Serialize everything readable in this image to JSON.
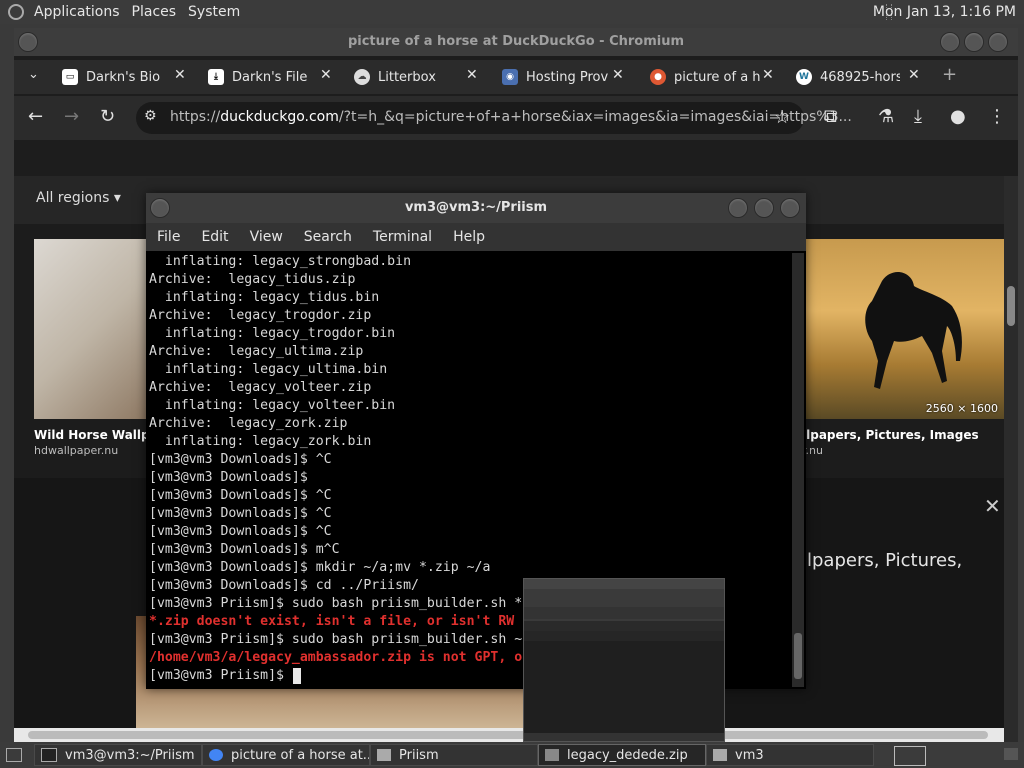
{
  "top_panel": {
    "menus": [
      "Applications",
      "Places",
      "System"
    ],
    "clock": "Mon Jan 13,  1:16 PM"
  },
  "chromium": {
    "title": "picture of a horse at DuckDuckGo - Chromium",
    "tabs": [
      {
        "label": "Darkn's Bio",
        "icon": "card-icon"
      },
      {
        "label": "Darkn's File I",
        "icon": "download-icon"
      },
      {
        "label": "Litterbox",
        "icon": "litterbox-icon"
      },
      {
        "label": "Hosting Prov",
        "icon": "hosting-icon"
      },
      {
        "label": "picture of a h",
        "icon": "duckduckgo-icon"
      },
      {
        "label": "468925-hors",
        "icon": "wordpress-icon"
      }
    ],
    "url_prefix": "https://",
    "url_domain": "duckduckgo.com",
    "url_rest": "/?t=h_&q=picture+of+a+horse&iax=images&ia=images&iai=https%3...",
    "page": {
      "region_filter": "All regions",
      "result_left": {
        "caption": "Wild Horse Wallpap",
        "source": "hdwallpaper.nu"
      },
      "result_right": {
        "caption": "llpapers, Pictures, Images",
        "source": "r.nu",
        "dims": "2560 × 1600"
      },
      "detail_title_line1": "llpapers, Pictures,",
      "detail_title_line2": ""
    }
  },
  "terminal": {
    "title": "vm3@vm3:~/Priism",
    "menus": [
      "File",
      "Edit",
      "View",
      "Search",
      "Terminal",
      "Help"
    ],
    "lines": [
      {
        "text": "  inflating: legacy_strongbad.bin",
        "err": false
      },
      {
        "text": "Archive:  legacy_tidus.zip",
        "err": false
      },
      {
        "text": "  inflating: legacy_tidus.bin",
        "err": false
      },
      {
        "text": "Archive:  legacy_trogdor.zip",
        "err": false
      },
      {
        "text": "  inflating: legacy_trogdor.bin",
        "err": false
      },
      {
        "text": "Archive:  legacy_ultima.zip",
        "err": false
      },
      {
        "text": "  inflating: legacy_ultima.bin",
        "err": false
      },
      {
        "text": "Archive:  legacy_volteer.zip",
        "err": false
      },
      {
        "text": "  inflating: legacy_volteer.bin",
        "err": false
      },
      {
        "text": "Archive:  legacy_zork.zip",
        "err": false
      },
      {
        "text": "  inflating: legacy_zork.bin",
        "err": false
      },
      {
        "text": "[vm3@vm3 Downloads]$ ^C",
        "err": false
      },
      {
        "text": "[vm3@vm3 Downloads]$",
        "err": false
      },
      {
        "text": "[vm3@vm3 Downloads]$ ^C",
        "err": false
      },
      {
        "text": "[vm3@vm3 Downloads]$ ^C",
        "err": false
      },
      {
        "text": "[vm3@vm3 Downloads]$ ^C",
        "err": false
      },
      {
        "text": "[vm3@vm3 Downloads]$ m^C",
        "err": false
      },
      {
        "text": "[vm3@vm3 Downloads]$ mkdir ~/a;mv *.zip ~/a",
        "err": false
      },
      {
        "text": "[vm3@vm3 Downloads]$ cd ../Priism/",
        "err": false
      },
      {
        "text": "[vm3@vm3 Priism]$ sudo bash priism_builder.sh *",
        "err": false
      },
      {
        "text": "*.zip doesn't exist, isn't a file, or isn't RW",
        "err": true
      },
      {
        "text": "[vm3@vm3 Priism]$ sudo bash priism_builder.sh ~",
        "err": false
      },
      {
        "text": "/home/vm3/a/legacy_ambassador.zip is not GPT, o",
        "err": true
      },
      {
        "text": "[vm3@vm3 Priism]$ ",
        "err": false
      }
    ]
  },
  "taskbar": {
    "items": [
      {
        "label": "vm3@vm3:~/Priism",
        "icon": "terminal-icon"
      },
      {
        "label": "picture of a horse at...",
        "icon": "chromium-icon"
      },
      {
        "label": "Priism",
        "icon": "folder-icon"
      },
      {
        "label": "legacy_dedede.zip",
        "icon": "archive-icon"
      },
      {
        "label": "vm3",
        "icon": "folder-icon"
      }
    ]
  }
}
